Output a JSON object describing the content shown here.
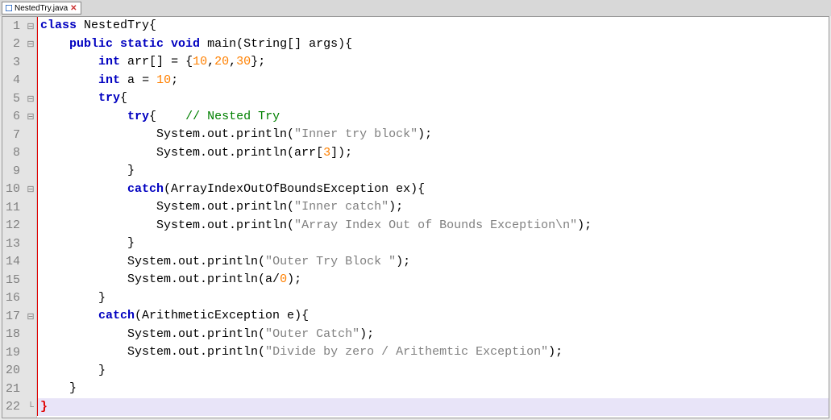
{
  "tab": {
    "filename": "NestedTry.java"
  },
  "code": {
    "line1": {
      "class_kw": "class",
      "name": "NestedTry",
      "brace": "{"
    },
    "line2": {
      "mods": "public static void",
      "name": "main",
      "params": "(String[] args)",
      "brace": "{"
    },
    "line3": {
      "type": "int",
      "var": "arr[]",
      "eq": " = ",
      "vals": "{10,20,30}",
      "semi": ";",
      "n1": "10",
      "n2": "20",
      "n3": "30"
    },
    "line4": {
      "type": "int",
      "var": "a",
      "eq": " = ",
      "val": "10",
      "semi": ";"
    },
    "line5": {
      "try": "try",
      "brace": "{"
    },
    "line6": {
      "try": "try",
      "brace": "{",
      "comment": "// Nested Try"
    },
    "line7": {
      "call": "System.out.println(",
      "str": "\"Inner try block\"",
      "end": ");"
    },
    "line8": {
      "call": "System.out.println(arr[",
      "idx": "3",
      "end": "]);"
    },
    "line9": {
      "brace": "}"
    },
    "line10": {
      "catch": "catch",
      "params": "(ArrayIndexOutOfBoundsException ex)",
      "brace": "{"
    },
    "line11": {
      "call": "System.out.println(",
      "str": "\"Inner catch\"",
      "end": ");"
    },
    "line12": {
      "call": "System.out.println(",
      "str": "\"Array Index Out of Bounds Exception\\n\"",
      "end": ");"
    },
    "line13": {
      "brace": "}"
    },
    "line14": {
      "call": "System.out.println(",
      "str": "\"Outer Try Block \"",
      "end": ");"
    },
    "line15": {
      "call": "System.out.println(a/",
      "num": "0",
      "end": ");"
    },
    "line16": {
      "brace": "}"
    },
    "line17": {
      "catch": "catch",
      "params": "(ArithmeticException e)",
      "brace": "{"
    },
    "line18": {
      "call": "System.out.println(",
      "str": "\"Outer Catch\"",
      "end": ");"
    },
    "line19": {
      "call": "System.out.println(",
      "str": "\"Divide by zero / Arithemtic Exception\"",
      "end": ");"
    },
    "line20": {
      "brace": "}"
    },
    "line21": {
      "brace": "}"
    },
    "line22": {
      "brace": "}"
    }
  },
  "line_numbers": [
    "1",
    "2",
    "3",
    "4",
    "5",
    "6",
    "7",
    "8",
    "9",
    "10",
    "11",
    "12",
    "13",
    "14",
    "15",
    "16",
    "17",
    "18",
    "19",
    "20",
    "21",
    "22"
  ],
  "fold_markers": {
    "1": "⊟",
    "2": "⊟",
    "5": "⊟",
    "6": "⊟",
    "10": "⊟",
    "17": "⊟",
    "22": "└"
  }
}
